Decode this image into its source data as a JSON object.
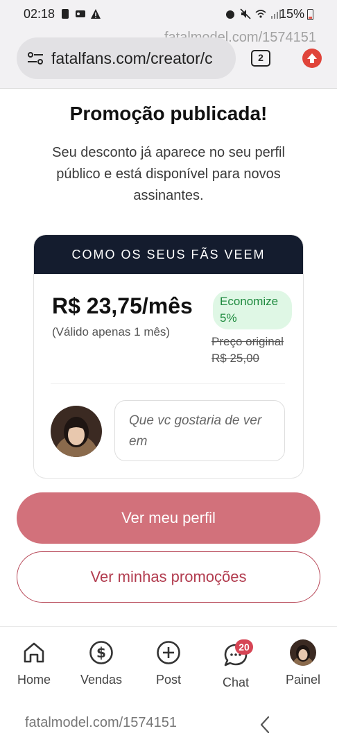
{
  "status_bar": {
    "time": "02:18",
    "battery": "15%"
  },
  "browser": {
    "watermark": "fatalmodel.com/1574151",
    "url": "fatalfans.com/creator/c",
    "tab_count": "2"
  },
  "page": {
    "title": "Promoção publicada!",
    "subtitle": "Seu desconto já aparece no seu perfil público e está disponível para novos assinantes."
  },
  "preview_card": {
    "header": "COMO OS SEUS FÃS VEEM",
    "price": "R$ 23,75/mês",
    "validity": "(Válido apenas 1 mês)",
    "save_badge": "Economize 5%",
    "original_price_label": "Preço original",
    "original_price_value": "R$ 25,00",
    "message_placeholder": "Que vc gostaria de ver em"
  },
  "actions": {
    "primary_label": "Ver meu perfil",
    "secondary_label": "Ver minhas promoções"
  },
  "bottom_nav": {
    "items": [
      {
        "label": "Home",
        "icon": "home-icon"
      },
      {
        "label": "Vendas",
        "icon": "dollar-icon"
      },
      {
        "label": "Post",
        "icon": "plus-circle-icon"
      },
      {
        "label": "Chat",
        "icon": "chat-icon",
        "badge": "20"
      },
      {
        "label": "Painel",
        "icon": "avatar"
      }
    ]
  },
  "system_nav": {
    "watermark": "fatalmodel.com/1574151"
  },
  "colors": {
    "primary": "#d2717b",
    "outline": "#b23c4f",
    "card_header": "#141c2e",
    "save_badge_bg": "#dff7e5",
    "save_badge_text": "#1e8a3e",
    "chat_badge": "#d64555"
  }
}
